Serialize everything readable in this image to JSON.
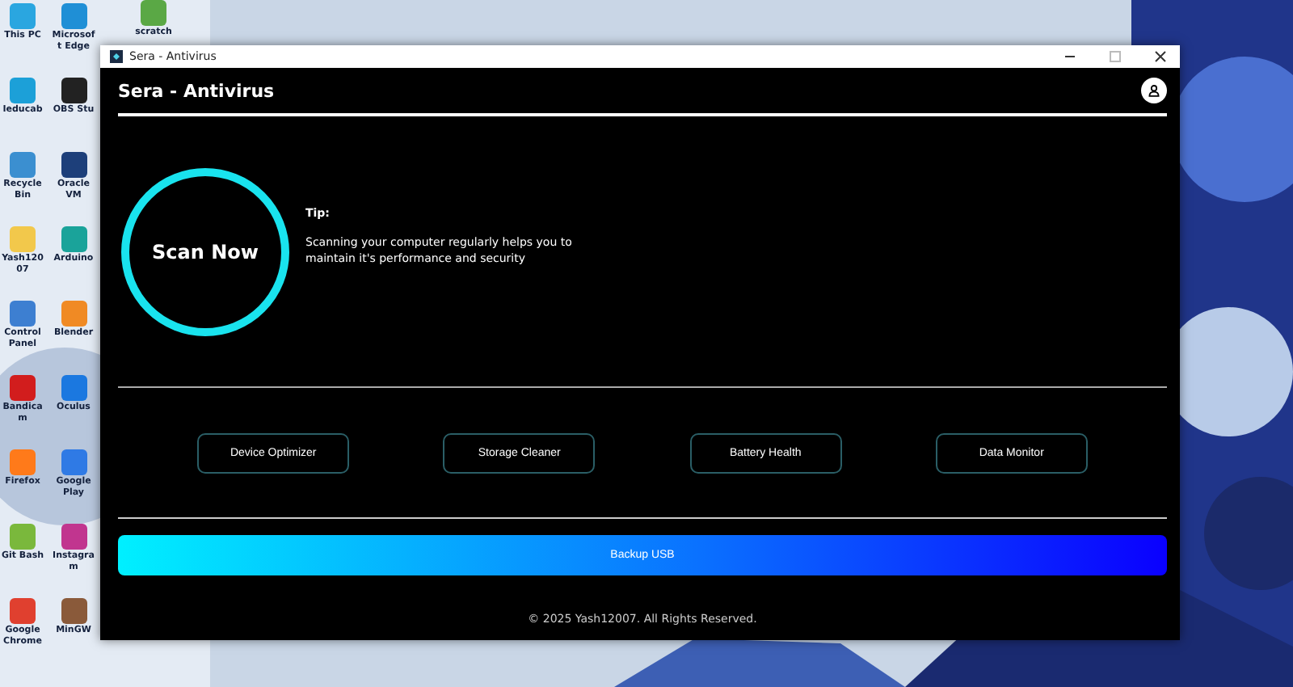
{
  "desktop": {
    "column_1": [
      {
        "label": "This PC",
        "color": "#2aa6e0"
      },
      {
        "label": "Ieducab",
        "color": "#1ca0d8"
      },
      {
        "label": "Recycle Bin",
        "color": "#3b8fd0"
      },
      {
        "label": "Yash12007",
        "color": "#f2c84b"
      },
      {
        "label": "Control Panel",
        "color": "#3d7fd1"
      },
      {
        "label": "Bandicam",
        "color": "#d21d1d"
      },
      {
        "label": "Firefox",
        "color": "#ff7a1a"
      },
      {
        "label": "Git Bash",
        "color": "#7ab83c"
      },
      {
        "label": "Google Chrome",
        "color": "#e0402f"
      }
    ],
    "column_2": [
      {
        "label": "Microsoft Edge",
        "color": "#1f8fd6"
      },
      {
        "label": "OBS Stu",
        "color": "#222222"
      },
      {
        "label": "Oracle VM",
        "color": "#1d3f7a"
      },
      {
        "label": "Arduino",
        "color": "#1aa39a"
      },
      {
        "label": "Blender",
        "color": "#f08a24"
      },
      {
        "label": "Oculus",
        "color": "#1b78e0"
      },
      {
        "label": "Google Play",
        "color": "#2f7ae5"
      },
      {
        "label": "Instagram",
        "color": "#c1358f"
      },
      {
        "label": "MinGW",
        "color": "#8a5a3a"
      }
    ],
    "column_3": [
      {
        "label": "scratch",
        "color": "#5aa845"
      }
    ]
  },
  "window": {
    "title": "Sera - Antivirus"
  },
  "app": {
    "header": "Sera - Antivirus",
    "scan_button": "Scan Now",
    "tip": {
      "heading": "Tip:",
      "text": "Scanning your computer regularly helps you to maintain it's performance and security"
    },
    "tools": [
      "Device Optimizer",
      "Storage Cleaner",
      "Battery Health",
      "Data Monitor"
    ],
    "backup_button": "Backup USB",
    "footer": "© 2025 Yash12007. All Rights Reserved."
  }
}
